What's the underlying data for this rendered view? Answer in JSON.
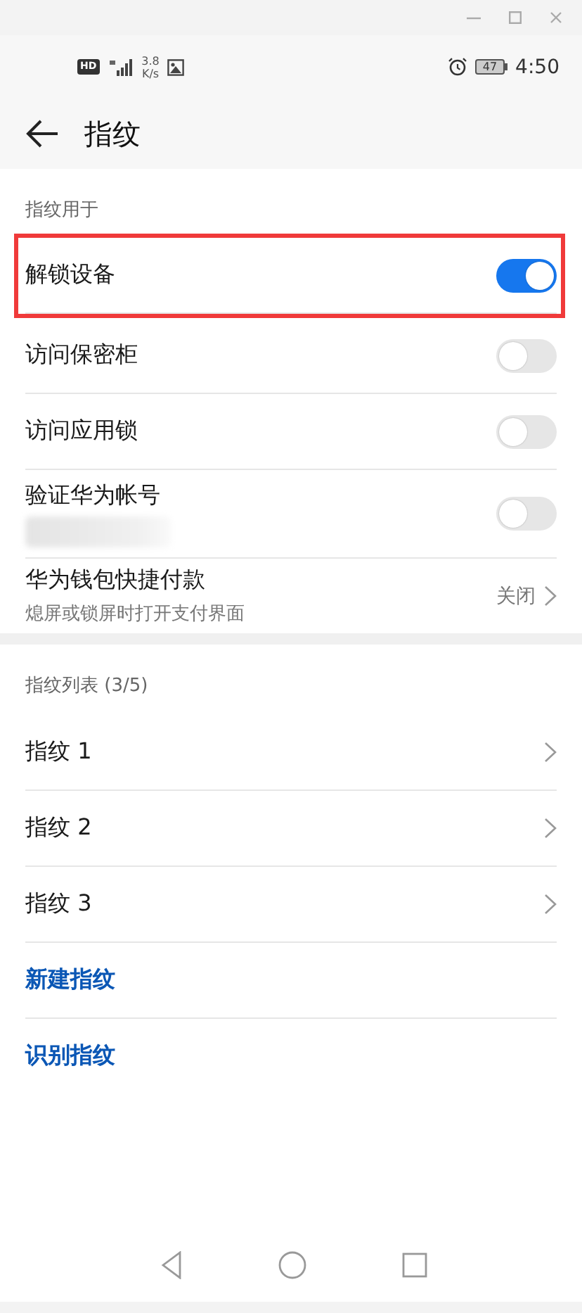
{
  "status_bar": {
    "hd_badge": "HD",
    "speed": [
      "3.8",
      "K/s"
    ],
    "battery": "47",
    "time": "4:50"
  },
  "header": {
    "title": "指纹"
  },
  "sections": [
    {
      "title": "指纹用于",
      "items": [
        {
          "kind": "toggle",
          "label": "解锁设备",
          "on": true,
          "highlighted": true
        },
        {
          "kind": "toggle",
          "label": "访问保密柜",
          "on": false,
          "highlighted": false
        },
        {
          "kind": "toggle",
          "label": "访问应用锁",
          "on": false,
          "highlighted": false
        },
        {
          "kind": "toggle",
          "label": "验证华为帐号",
          "on": false,
          "highlighted": false,
          "redacted_subtitle": true
        },
        {
          "kind": "value",
          "label": "华为钱包快捷付款",
          "subtitle": "熄屏或锁屏时打开支付界面",
          "value": "关闭",
          "highlighted": false
        }
      ]
    },
    {
      "title": "指纹列表 (3/5)",
      "items": [
        {
          "kind": "link",
          "label": "指纹 1",
          "highlighted": false
        },
        {
          "kind": "link",
          "label": "指纹 2",
          "highlighted": false
        },
        {
          "kind": "link",
          "label": "指纹 3",
          "highlighted": false
        },
        {
          "kind": "action",
          "label": "新建指纹",
          "highlighted": false
        },
        {
          "kind": "action",
          "label": "识别指纹",
          "highlighted": false
        }
      ]
    }
  ]
}
